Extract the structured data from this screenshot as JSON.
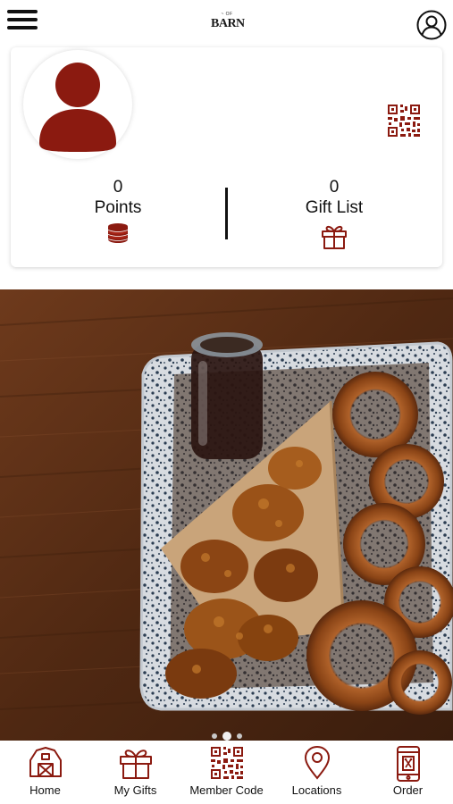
{
  "header": {
    "menu_icon": "hamburger-menu-icon",
    "logo_small": "~ OF",
    "logo_text": "BARN",
    "profile_icon": "user-circle-icon"
  },
  "profile_card": {
    "avatar_icon": "person-icon",
    "qr_icon": "qr-code-icon",
    "points": {
      "value": "0",
      "label": "Points",
      "icon": "coin-stack-icon"
    },
    "gifts": {
      "value": "0",
      "label": "Gift List",
      "icon": "gift-icon"
    }
  },
  "banner": {
    "image_icon": "food-photo",
    "slides_total": 3,
    "active_slide": 2
  },
  "tabbar": {
    "items": [
      {
        "label": "Home",
        "icon": "barn-icon"
      },
      {
        "label": "My Gifts",
        "icon": "gift-icon"
      },
      {
        "label": "Member Code",
        "icon": "qr-code-icon"
      },
      {
        "label": "Locations",
        "icon": "map-pin-icon"
      },
      {
        "label": "Order",
        "icon": "phone-order-icon"
      }
    ]
  },
  "colors": {
    "brand": "#8b1a10",
    "text": "#111111",
    "background": "#ffffff"
  }
}
